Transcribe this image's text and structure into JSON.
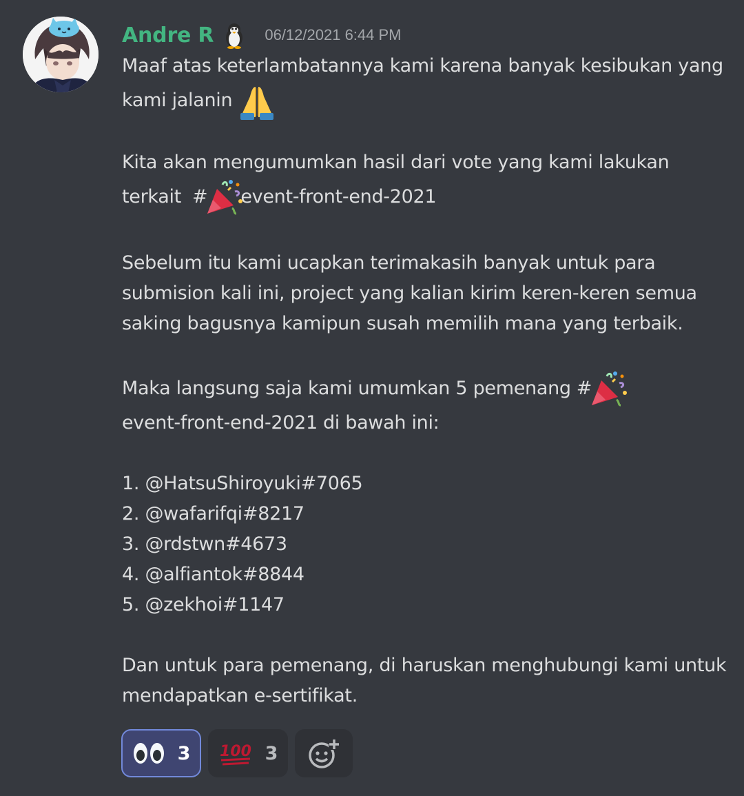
{
  "message": {
    "author": "Andre R",
    "timestamp": "06/12/2021 6:44 PM",
    "avatar_icon": "anime-avatar",
    "author_badge_icon": "penguin-icon",
    "paragraphs": {
      "p1_l1": "Maaf atas keterlambatannya kami karena banyak kesibukan yang",
      "p1_l2": "kami jalanin",
      "p2_l1": "Kita akan mengumumkan hasil dari vote yang kami lakukan",
      "p2_l2_prefix": "terkait",
      "channel_mention": "#",
      "channel_name": "event-front-end-2021",
      "p3_l1": "Sebelum itu kami ucapkan terimakasih banyak untuk para",
      "p3_l2": "submision kali ini, project yang kalian kirim keren-keren semua",
      "p3_l3": "saking bagusnya kamipun susah memilih mana yang terbaik.",
      "p4_l1_prefix": "Maka langsung saja kami umumkan 5 pemenang",
      "p4_l2_suffix": "di bawah ini:",
      "p6_l1": "Dan untuk para pemenang, di haruskan menghubungi kami untuk",
      "p6_l2": "mendapatkan e-sertifikat."
    },
    "winners": [
      "1. @HatsuShiroyuki#7065",
      "2. @wafarifqi#8217",
      "3. @rdstwn#4673",
      "4. @alfiantok#8844",
      "5. @zekhoi#1147"
    ],
    "inline_emoji": {
      "pray": "pray-emoji",
      "party": "party-popper-emoji"
    }
  },
  "reactions": [
    {
      "icon": "eyes-emoji",
      "count": "3",
      "active": true
    },
    {
      "icon": "hundred-emoji",
      "count": "3",
      "active": false
    },
    {
      "icon": "add-reaction-icon",
      "count": "",
      "active": false
    }
  ],
  "colors": {
    "background": "#36393f",
    "username": "#43b581",
    "text": "#dcddde",
    "timestamp": "#a3a6aa",
    "reaction_active_border": "#7289da",
    "reaction_active_bg": "#3f4571",
    "reaction_bg": "#2f3136"
  }
}
